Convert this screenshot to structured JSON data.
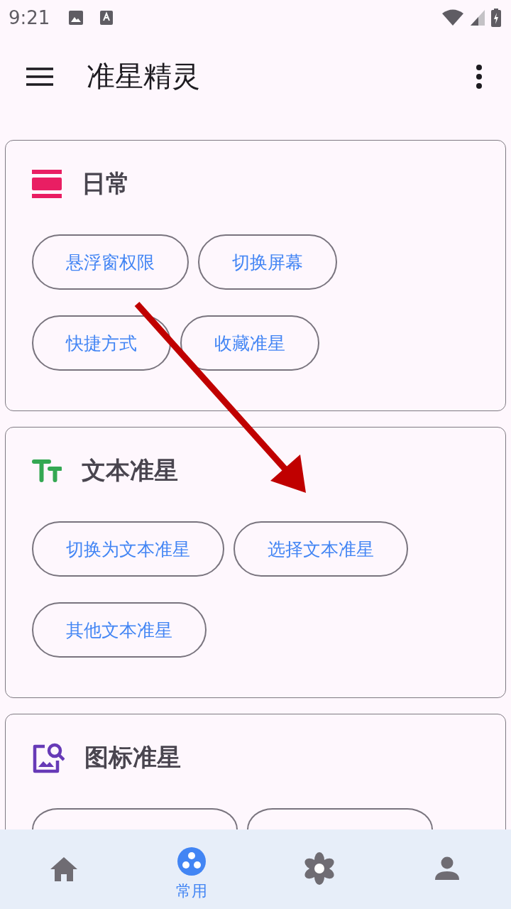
{
  "status_bar": {
    "time": "9:21"
  },
  "app_bar": {
    "title": "准星精灵"
  },
  "cards": [
    {
      "kind": "daily",
      "title": "日常",
      "chips": [
        "悬浮窗权限",
        "切换屏幕",
        "快捷方式",
        "收藏准星"
      ]
    },
    {
      "kind": "text",
      "title": "文本准星",
      "chips": [
        "切换为文本准星",
        "选择文本准星",
        "其他文本准星"
      ]
    },
    {
      "kind": "icon",
      "title": "图标准星"
    }
  ],
  "bottom_nav": [
    {
      "kind": "home",
      "selected": false
    },
    {
      "kind": "common",
      "label": "常用",
      "selected": true
    },
    {
      "kind": "flower",
      "selected": false
    },
    {
      "kind": "person",
      "selected": false
    }
  ]
}
